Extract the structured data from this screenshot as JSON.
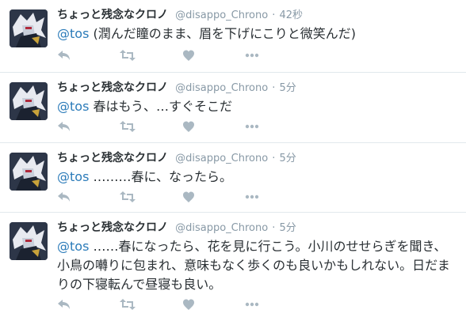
{
  "tweets": [
    {
      "name": "ちょっと残念なクロノ",
      "handle": "@disappo_Chrono",
      "separator": "·",
      "time": "42秒",
      "mention": "@tos",
      "body": " (潤んだ瞳のまま、眉を下げにこりと微笑んだ)"
    },
    {
      "name": "ちょっと残念なクロノ",
      "handle": "@disappo_Chrono",
      "separator": "·",
      "time": "5分",
      "mention": "@tos",
      "body": " 春はもう、…すぐそこだ"
    },
    {
      "name": "ちょっと残念なクロノ",
      "handle": "@disappo_Chrono",
      "separator": "·",
      "time": "5分",
      "mention": "@tos",
      "body": " ………春に、なったら。"
    },
    {
      "name": "ちょっと残念なクロノ",
      "handle": "@disappo_Chrono",
      "separator": "·",
      "time": "5分",
      "mention": "@tos",
      "body": " ……春になったら、花を見に行こう。小川のせせらぎを聞き、小鳥の囀りに包まれ、意味もなく歩くのも良いかもしれない。日だまりの下寝転んで昼寝も良い。"
    }
  ],
  "icons": {
    "reply": "reply-icon",
    "retweet": "retweet-icon",
    "like": "heart-icon",
    "more": "more-icon"
  },
  "colors": {
    "mention": "#2b7bb9",
    "meta": "#8899a6",
    "icon": "#aab8c2",
    "divider": "#e1e8ed"
  }
}
